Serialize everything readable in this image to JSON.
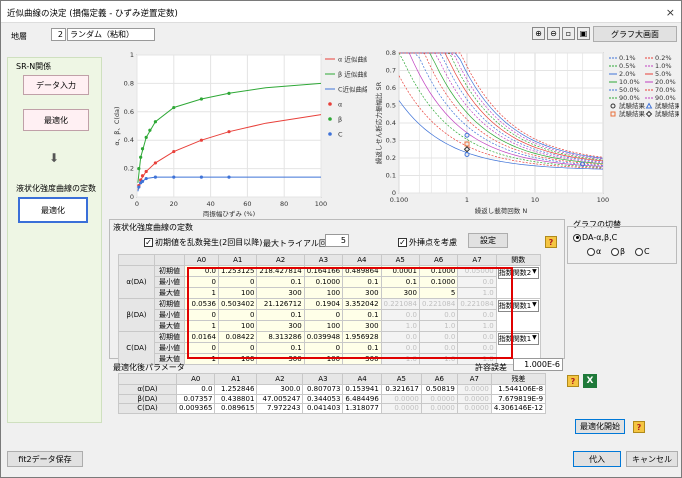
{
  "window": {
    "title": "近似曲線の決定 (損傷定義 - ひずみ逆置定数)",
    "close": "×"
  },
  "toolbar": {
    "layer_label": "地層",
    "layer_no": "2",
    "layer_name": "ランダム（粘和）",
    "graph_large": "グラフ大画面"
  },
  "left": {
    "sr_title": "SR-N関係",
    "data_input": "データ入力",
    "optimize": "最適化",
    "arrow": "⬇",
    "liq_title": "液状化強度曲線の定数",
    "liq_optimize": "最適化"
  },
  "chart1": {
    "ylabel": "α、β、C(da)",
    "xlabel": "両振幅ひずみ (%)"
  },
  "chart_data": [
    {
      "type": "line",
      "xlim": [
        0,
        100
      ],
      "ylim": [
        0,
        1
      ],
      "x_ticks": [
        "0",
        "20",
        "40",
        "60",
        "80",
        "100"
      ],
      "y_ticks": [
        "0",
        "0.2",
        "0.4",
        "0.6",
        "0.8",
        "1"
      ],
      "series": [
        {
          "name": "α 近似曲線",
          "color": "#e8403a",
          "kind": "line",
          "x": [
            0.5,
            2,
            5,
            10,
            20,
            35,
            50,
            70,
            100
          ],
          "y": [
            0.05,
            0.12,
            0.18,
            0.24,
            0.32,
            0.4,
            0.46,
            0.52,
            0.58
          ]
        },
        {
          "name": "β 近似曲線",
          "color": "#2ea836",
          "kind": "line",
          "x": [
            0.5,
            2,
            5,
            10,
            20,
            35,
            50,
            70,
            100
          ],
          "y": [
            0.1,
            0.28,
            0.42,
            0.53,
            0.63,
            0.69,
            0.73,
            0.77,
            0.8
          ]
        },
        {
          "name": "C近似曲線",
          "color": "#3f73d8",
          "kind": "line",
          "x": [
            0.5,
            1,
            2,
            5,
            10,
            20,
            50,
            100
          ],
          "y": [
            0.04,
            0.07,
            0.1,
            0.13,
            0.14,
            0.14,
            0.14,
            0.14
          ]
        },
        {
          "name": "α",
          "color": "#e8403a",
          "kind": "point",
          "x": [
            1,
            2,
            3,
            5,
            10,
            20,
            35,
            50
          ],
          "y": [
            0.08,
            0.12,
            0.15,
            0.18,
            0.24,
            0.32,
            0.4,
            0.46
          ]
        },
        {
          "name": "β",
          "color": "#2ea836",
          "kind": "point",
          "x": [
            1,
            2,
            3,
            5,
            7,
            10,
            20,
            35,
            50
          ],
          "y": [
            0.2,
            0.28,
            0.34,
            0.42,
            0.47,
            0.53,
            0.63,
            0.69,
            0.73
          ]
        },
        {
          "name": "C",
          "color": "#3f73d8",
          "kind": "point",
          "x": [
            1,
            2,
            3,
            5,
            10,
            20,
            35,
            50
          ],
          "y": [
            0.07,
            0.1,
            0.11,
            0.13,
            0.14,
            0.14,
            0.14,
            0.14
          ]
        }
      ]
    },
    {
      "type": "line",
      "xscale": "log",
      "xlim": [
        0.1,
        100
      ],
      "ylim": [
        0,
        0.8
      ],
      "ylabel": "繰返しせん断応力振幅比 SR",
      "xlabel": "繰返し載荷回数 N",
      "x_ticks": [
        "0.100",
        "1",
        "10",
        "100"
      ],
      "y_ticks": [
        "0",
        "0.1",
        "0.2",
        "0.3",
        "0.4",
        "0.5",
        "0.6",
        "0.7",
        "0.8"
      ],
      "legend": [
        [
          "0.1%",
          "#3f73d8",
          "dash"
        ],
        [
          "0.2%",
          "#e8403a",
          "dash"
        ],
        [
          "0.5%",
          "#2ea836",
          "dash"
        ],
        [
          "1.0%",
          "#c040c0",
          "dash"
        ],
        [
          "2.0%",
          "#3f73d8",
          "solid"
        ],
        [
          "5.0%",
          "#e8403a",
          "solid"
        ],
        [
          "10.0%",
          "#2ea836",
          "solid"
        ],
        [
          "20.0%",
          "#c040c0",
          "solid"
        ],
        [
          "50.0%",
          "#3f73d8",
          "dash"
        ],
        [
          "70.0%",
          "#e8403a",
          "dash"
        ],
        [
          "90.0%",
          "#2ea836",
          "dash"
        ],
        [
          "90.0%",
          "#c040c0",
          "dash"
        ],
        [
          "試験結果",
          "#333",
          "circle"
        ],
        [
          "試験結果",
          "#3f73d8",
          "triangle"
        ],
        [
          "試験結果",
          "#e8703a",
          "square"
        ],
        [
          "試験結果",
          "#333",
          "diamond"
        ]
      ]
    }
  ],
  "params_section": {
    "title": "液状化強度曲線の定数",
    "init_random": "初期値を乱数発生(2回目以降)",
    "max_trial_label": "最大トライアル回数",
    "max_trial": "5",
    "exclude_outliers": "外挿点を考慮",
    "settings": "設定"
  },
  "graph_switch": {
    "title": "グラフの切替",
    "options": [
      "DA-α,β,C",
      "α",
      "β",
      "C"
    ]
  },
  "param_table": {
    "headers": [
      "",
      "",
      "A0",
      "A1",
      "A2",
      "A3",
      "A4",
      "A5",
      "A6",
      "A7",
      "関数"
    ],
    "groups": [
      {
        "name": "α(DA)",
        "func": "指数関数2",
        "rows": [
          {
            "label": "初期値",
            "vals": [
              "0.0",
              "1.253125",
              "218.427814",
              "0.164166",
              "0.489864",
              "0.0001",
              "0.1000",
              "0.05000"
            ],
            "dis": [
              0,
              0,
              0,
              0,
              0,
              0,
              0,
              1
            ]
          },
          {
            "label": "最小値",
            "vals": [
              "0",
              "0",
              "0.1",
              "0.1000",
              "0.1",
              "0.1",
              "0.1000",
              "0.0"
            ],
            "dis": [
              0,
              0,
              0,
              0,
              0,
              0,
              0,
              1
            ]
          },
          {
            "label": "最大値",
            "vals": [
              "1",
              "100",
              "300",
              "100",
              "300",
              "300",
              "5",
              "1.0"
            ],
            "dis": [
              0,
              0,
              0,
              0,
              0,
              0,
              0,
              1
            ]
          }
        ]
      },
      {
        "name": "β(DA)",
        "func": "指数関数1",
        "rows": [
          {
            "label": "初期値",
            "vals": [
              "0.0536",
              "0.503402",
              "21.126712",
              "0.1904",
              "3.352042",
              "0.221084",
              "0.221084",
              "0.221084"
            ],
            "dis": [
              0,
              0,
              0,
              0,
              0,
              1,
              1,
              1
            ]
          },
          {
            "label": "最小値",
            "vals": [
              "0",
              "0",
              "0.1",
              "0",
              "0.1",
              "0.0",
              "0.0",
              "0.0"
            ],
            "dis": [
              0,
              0,
              0,
              0,
              0,
              1,
              1,
              1
            ]
          },
          {
            "label": "最大値",
            "vals": [
              "1",
              "100",
              "300",
              "100",
              "300",
              "1.0",
              "1.0",
              "1.0"
            ],
            "dis": [
              0,
              0,
              0,
              0,
              0,
              1,
              1,
              1
            ]
          }
        ]
      },
      {
        "name": "C(DA)",
        "func": "指数関数1",
        "rows": [
          {
            "label": "初期値",
            "vals": [
              "0.0164",
              "0.08422",
              "8.313286",
              "0.039948",
              "1.956928",
              "0.0",
              "0.0",
              "0.0"
            ],
            "dis": [
              0,
              0,
              0,
              0,
              0,
              1,
              1,
              1
            ]
          },
          {
            "label": "最小値",
            "vals": [
              "0",
              "0",
              "0.1",
              "0",
              "0.1",
              "0.0",
              "0.0",
              "0.0"
            ],
            "dis": [
              0,
              0,
              0,
              0,
              0,
              1,
              1,
              1
            ]
          },
          {
            "label": "最大値",
            "vals": [
              "1",
              "100",
              "300",
              "100",
              "300",
              "1.0",
              "1.0",
              "1.0"
            ],
            "dis": [
              0,
              0,
              0,
              0,
              0,
              1,
              1,
              1
            ]
          }
        ]
      }
    ]
  },
  "result_section": {
    "title": "最適化後パラメータ",
    "tol_label": "許容誤差",
    "tol": "1.000E-6"
  },
  "result_table": {
    "headers": [
      "",
      "A0",
      "A1",
      "A2",
      "A3",
      "A4",
      "A5",
      "A6",
      "A7",
      "残差"
    ],
    "rows": [
      {
        "label": "α(DA)",
        "vals": [
          "0.0",
          "1.252846",
          "300.0",
          "0.807073",
          "0.153941",
          "0.321617",
          "0.50819",
          "0.0000",
          "1.544106E-8"
        ],
        "dis": [
          0,
          0,
          0,
          0,
          0,
          0,
          0,
          1,
          0
        ]
      },
      {
        "label": "β(DA)",
        "vals": [
          "0.07357",
          "0.438801",
          "47.005247",
          "0.344053",
          "6.484496",
          "0.0000",
          "0.0000",
          "0.0000",
          "7.679819E-9"
        ],
        "dis": [
          0,
          0,
          0,
          0,
          0,
          1,
          1,
          1,
          0
        ]
      },
      {
        "label": "C(DA)",
        "vals": [
          "0.009365",
          "0.089615",
          "7.972243",
          "0.041403",
          "1.318077",
          "0.0000",
          "0.0000",
          "0.0000",
          "4.306146E-12"
        ],
        "dis": [
          0,
          0,
          0,
          0,
          0,
          1,
          1,
          1,
          0
        ]
      }
    ]
  },
  "buttons": {
    "optimize_start": "最適化開始",
    "fit2_save": "fit2データ保存",
    "apply": "代入",
    "cancel": "キャンセル",
    "help": "?",
    "excel": "X"
  },
  "colors": {
    "highlight": "#e00000",
    "panel_green": "#eef6e4",
    "table_yellow": "#ffffe8"
  }
}
